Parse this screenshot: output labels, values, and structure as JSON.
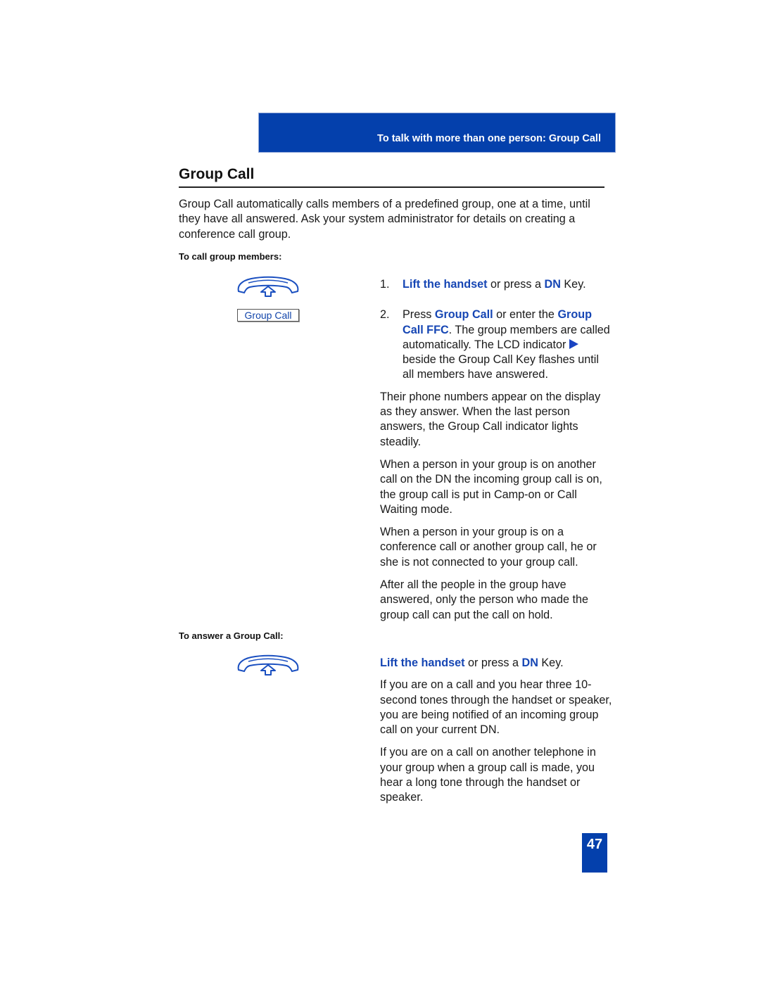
{
  "header": {
    "band_title": "To talk with more than one person: Group Call",
    "accent_color": "#0440ac"
  },
  "page_title": "Group Call",
  "intro": "Group Call automatically calls members of a predefined group, one at a time, until they have all answered. Ask your system administrator for details on creating a conference call group.",
  "section_call": {
    "heading": "To call group members:",
    "handset_icon": "handset-lift-icon",
    "softkey_label": "Group Call",
    "steps": [
      {
        "num": "1.",
        "parts": [
          "Lift the handset",
          " or press a ",
          "DN",
          " Key."
        ]
      },
      {
        "num": "2.",
        "parts": [
          "Press ",
          "Group Call",
          " or enter the ",
          "Group Call FFC",
          ". The group members are called automatically. The LCD indicator ",
          " beside the Group Call Key flashes until all members have answered."
        ]
      }
    ],
    "paragraphs": [
      "Their phone numbers appear on the display as they answer. When the last person answers, the Group Call indicator lights steadily.",
      "When a person in your group is on another call on the DN the incoming group call is on, the group call is put in Camp-on or Call Waiting mode.",
      "When a person in your group is on a conference call or another group call, he or she is not connected to your group call.",
      "After all the people in the group have answered, only the person who made the group call can put the call on hold."
    ]
  },
  "section_answer": {
    "heading": "To answer a Group Call:",
    "handset_icon": "handset-lift-icon",
    "action_parts": [
      "Lift the handset",
      " or press a ",
      "DN",
      " Key."
    ],
    "paragraphs": [
      "If you are on a call and you hear three 10-second tones through the handset or speaker, you are being notified of an incoming group call on your current DN.",
      "If you are on a call on another telephone in your group when a group call is made, you hear a long tone through the handset or speaker."
    ]
  },
  "page_number": "47"
}
